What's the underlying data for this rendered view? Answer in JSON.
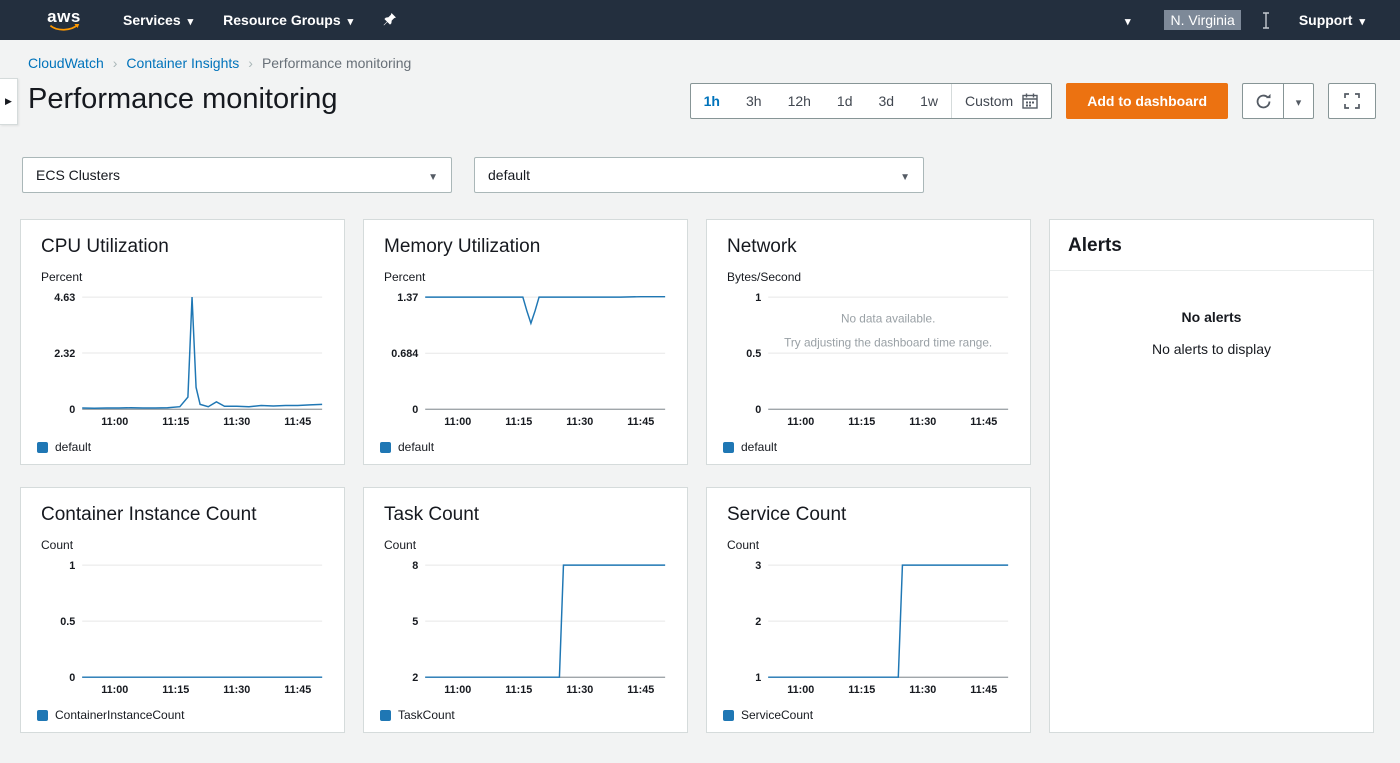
{
  "colors": {
    "nav_bg": "#232f3e",
    "accent_orange": "#ec7211",
    "link_blue": "#0073bb",
    "series": "#1f77b4"
  },
  "topnav": {
    "logo": "aws",
    "services": "Services",
    "resource_groups": "Resource Groups",
    "region": "N. Virginia",
    "support": "Support"
  },
  "breadcrumb": {
    "items": [
      {
        "label": "CloudWatch"
      },
      {
        "label": "Container Insights"
      },
      {
        "label": "Performance monitoring"
      }
    ]
  },
  "page": {
    "title": "Performance monitoring"
  },
  "time_controls": {
    "ranges": [
      "1h",
      "3h",
      "12h",
      "1d",
      "3d",
      "1w"
    ],
    "selected": "1h",
    "custom_label": "Custom",
    "add_to_dashboard_label": "Add to dashboard"
  },
  "filters": {
    "resource_type": "ECS Clusters",
    "cluster": "default"
  },
  "alerts": {
    "title": "Alerts",
    "headline": "No alerts",
    "message": "No alerts to display"
  },
  "charts": [
    {
      "id": "cpu-utilization",
      "type": "line",
      "title": "CPU Utilization",
      "unit": "Percent",
      "legend": "default",
      "xmin": 0,
      "xmax": 59,
      "ymin": 0,
      "ymax": 4.63,
      "yticks": [
        {
          "v": 0,
          "label": "0"
        },
        {
          "v": 2.32,
          "label": "2.32"
        },
        {
          "v": 4.63,
          "label": "4.63"
        }
      ],
      "xticks": [
        {
          "v": 8,
          "label": "11:00"
        },
        {
          "v": 23,
          "label": "11:15"
        },
        {
          "v": 38,
          "label": "11:30"
        },
        {
          "v": 53,
          "label": "11:45"
        }
      ],
      "points": [
        [
          0,
          0.05
        ],
        [
          3,
          0.04
        ],
        [
          6,
          0.05
        ],
        [
          9,
          0.05
        ],
        [
          12,
          0.06
        ],
        [
          15,
          0.05
        ],
        [
          18,
          0.05
        ],
        [
          21,
          0.06
        ],
        [
          24,
          0.1
        ],
        [
          26,
          0.5
        ],
        [
          27,
          4.63
        ],
        [
          28,
          0.9
        ],
        [
          29,
          0.2
        ],
        [
          31,
          0.1
        ],
        [
          33,
          0.3
        ],
        [
          35,
          0.12
        ],
        [
          38,
          0.12
        ],
        [
          41,
          0.1
        ],
        [
          44,
          0.15
        ],
        [
          47,
          0.13
        ],
        [
          50,
          0.15
        ],
        [
          53,
          0.15
        ],
        [
          56,
          0.18
        ],
        [
          59,
          0.2
        ]
      ]
    },
    {
      "id": "memory-utilization",
      "type": "line",
      "title": "Memory Utilization",
      "unit": "Percent",
      "legend": "default",
      "xmin": 0,
      "xmax": 59,
      "ymin": 0,
      "ymax": 1.37,
      "yticks": [
        {
          "v": 0,
          "label": "0"
        },
        {
          "v": 0.684,
          "label": "0.684"
        },
        {
          "v": 1.37,
          "label": "1.37"
        }
      ],
      "xticks": [
        {
          "v": 8,
          "label": "11:00"
        },
        {
          "v": 23,
          "label": "11:15"
        },
        {
          "v": 38,
          "label": "11:30"
        },
        {
          "v": 53,
          "label": "11:45"
        }
      ],
      "points": [
        [
          0,
          1.37
        ],
        [
          5,
          1.37
        ],
        [
          10,
          1.37
        ],
        [
          15,
          1.37
        ],
        [
          20,
          1.37
        ],
        [
          24,
          1.37
        ],
        [
          25,
          1.2
        ],
        [
          26,
          1.05
        ],
        [
          27,
          1.2
        ],
        [
          28,
          1.37
        ],
        [
          33,
          1.37
        ],
        [
          38,
          1.37
        ],
        [
          43,
          1.37
        ],
        [
          48,
          1.37
        ],
        [
          53,
          1.375
        ],
        [
          59,
          1.375
        ]
      ]
    },
    {
      "id": "network",
      "type": "line",
      "title": "Network",
      "unit": "Bytes/Second",
      "legend": "default",
      "xmin": 0,
      "xmax": 59,
      "ymin": 0,
      "ymax": 1,
      "yticks": [
        {
          "v": 0,
          "label": "0"
        },
        {
          "v": 0.5,
          "label": "0.5"
        },
        {
          "v": 1,
          "label": "1"
        }
      ],
      "xticks": [
        {
          "v": 8,
          "label": "11:00"
        },
        {
          "v": 23,
          "label": "11:15"
        },
        {
          "v": 38,
          "label": "11:30"
        },
        {
          "v": 53,
          "label": "11:45"
        }
      ],
      "points": [],
      "no_data": {
        "line1": "No data available.",
        "line2": "Try adjusting the dashboard time range."
      }
    },
    {
      "id": "container-instance-count",
      "type": "line",
      "title": "Container Instance Count",
      "unit": "Count",
      "legend": "ContainerInstanceCount",
      "xmin": 0,
      "xmax": 59,
      "ymin": 0,
      "ymax": 1,
      "yticks": [
        {
          "v": 0,
          "label": "0"
        },
        {
          "v": 0.5,
          "label": "0.5"
        },
        {
          "v": 1,
          "label": "1"
        }
      ],
      "xticks": [
        {
          "v": 8,
          "label": "11:00"
        },
        {
          "v": 23,
          "label": "11:15"
        },
        {
          "v": 38,
          "label": "11:30"
        },
        {
          "v": 53,
          "label": "11:45"
        }
      ],
      "points": [
        [
          0,
          0
        ],
        [
          59,
          0
        ]
      ]
    },
    {
      "id": "task-count",
      "type": "line",
      "title": "Task Count",
      "unit": "Count",
      "legend": "TaskCount",
      "xmin": 0,
      "xmax": 59,
      "ymin": 2,
      "ymax": 8,
      "yticks": [
        {
          "v": 2,
          "label": "2"
        },
        {
          "v": 5,
          "label": "5"
        },
        {
          "v": 8,
          "label": "8"
        }
      ],
      "xticks": [
        {
          "v": 8,
          "label": "11:00"
        },
        {
          "v": 23,
          "label": "11:15"
        },
        {
          "v": 38,
          "label": "11:30"
        },
        {
          "v": 53,
          "label": "11:45"
        }
      ],
      "points": [
        [
          0,
          2
        ],
        [
          33,
          2
        ],
        [
          34,
          8
        ],
        [
          59,
          8
        ]
      ]
    },
    {
      "id": "service-count",
      "type": "line",
      "title": "Service Count",
      "unit": "Count",
      "legend": "ServiceCount",
      "xmin": 0,
      "xmax": 59,
      "ymin": 1,
      "ymax": 3,
      "yticks": [
        {
          "v": 1,
          "label": "1"
        },
        {
          "v": 2,
          "label": "2"
        },
        {
          "v": 3,
          "label": "3"
        }
      ],
      "xticks": [
        {
          "v": 8,
          "label": "11:00"
        },
        {
          "v": 23,
          "label": "11:15"
        },
        {
          "v": 38,
          "label": "11:30"
        },
        {
          "v": 53,
          "label": "11:45"
        }
      ],
      "points": [
        [
          0,
          1
        ],
        [
          32,
          1
        ],
        [
          33,
          3
        ],
        [
          59,
          3
        ]
      ]
    }
  ]
}
